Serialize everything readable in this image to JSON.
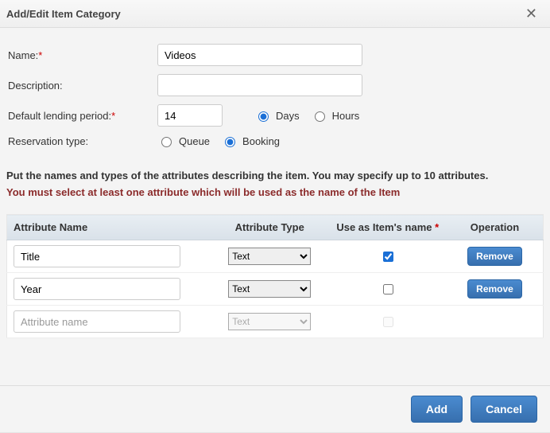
{
  "dialog": {
    "title": "Add/Edit Item Category",
    "close_glyph": "✕"
  },
  "form": {
    "name_label": "Name:",
    "name_value": "Videos",
    "description_label": "Description:",
    "description_value": "",
    "lending_label": "Default lending period:",
    "lending_value": "14",
    "days_label": "Days",
    "hours_label": "Hours",
    "reservation_label": "Reservation type:",
    "queue_label": "Queue",
    "booking_label": "Booking"
  },
  "messages": {
    "instruction": "Put the names and types of the attributes describing the item. You may specify up to 10 attributes.",
    "warning": "You must select at least one attribute which will be used as the name of the Item"
  },
  "table": {
    "headers": {
      "name": "Attribute Name",
      "type": "Attribute Type",
      "use": "Use as Item's name",
      "op": "Operation"
    },
    "type_option": "Text",
    "remove_label": "Remove",
    "placeholder": "Attribute name",
    "rows": [
      {
        "name": "Title"
      },
      {
        "name": "Year"
      }
    ]
  },
  "footer": {
    "add_label": "Add",
    "cancel_label": "Cancel"
  }
}
